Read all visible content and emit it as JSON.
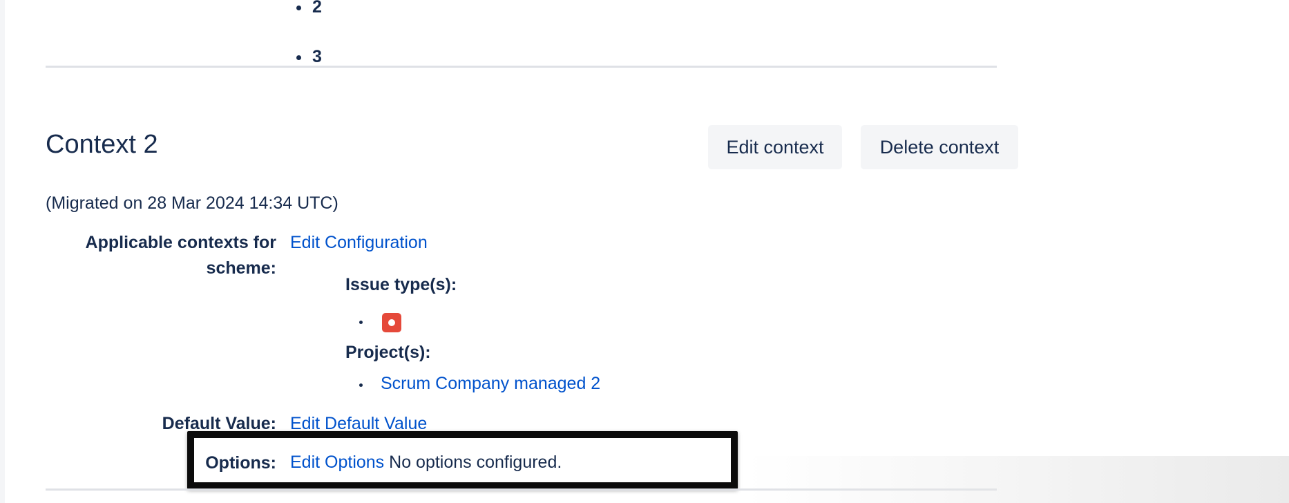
{
  "previous_context": {
    "list_items": [
      "2",
      "3"
    ]
  },
  "context": {
    "title": "Context 2",
    "edit_button_label": "Edit context",
    "delete_button_label": "Delete context",
    "migrated_text": "(Migrated on 28 Mar 2024 14:34 UTC)",
    "applicable_label": "Applicable contexts for scheme:",
    "edit_configuration_link": "Edit Configuration",
    "issue_types_heading": "Issue type(s):",
    "issue_type_icon": "bug-icon",
    "projects_heading": "Project(s):",
    "projects": [
      "Scrum Company managed 2"
    ],
    "default_value_label": "Default Value:",
    "edit_default_value_link": "Edit Default Value",
    "options_label": "Options:",
    "edit_options_link": "Edit Options",
    "options_status": "No options configured."
  },
  "colors": {
    "link": "#0052cc",
    "text": "#172b4d",
    "button_bg": "#f4f5f7",
    "bug_icon": "#e5493a",
    "highlight_border": "#0b0b0b"
  }
}
